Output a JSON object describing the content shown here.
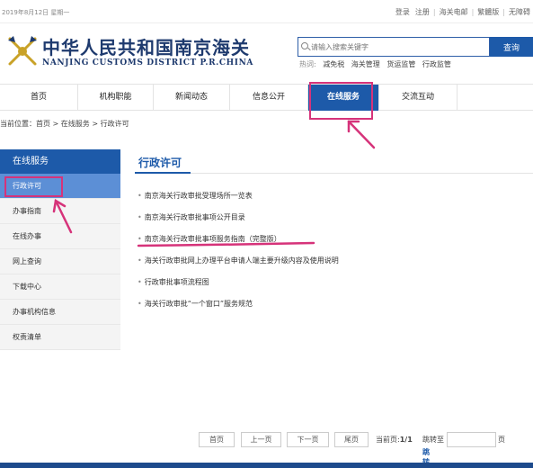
{
  "topbar": {
    "date": "2019年8月12日 星期一",
    "links": [
      "登录",
      "注册",
      "海关电邮",
      "繁體版",
      "无障碍"
    ]
  },
  "brand": {
    "title_cn": "中华人民共和国南京海关",
    "title_en": "NANJING CUSTOMS DISTRICT P.R.CHINA"
  },
  "search": {
    "placeholder": "请输入搜索关键字",
    "button": "查询",
    "hot_label": "热词:",
    "hot_words": [
      "减免税",
      "海关管理",
      "货运监管",
      "行政监管"
    ]
  },
  "nav": {
    "items": [
      "首页",
      "机构职能",
      "新闻动态",
      "信息公开",
      "在线服务",
      "交流互动"
    ],
    "active_index": 4
  },
  "breadcrumb": "当前位置：首页 > 在线服务 > 行政许可",
  "sidebar": {
    "title": "在线服务",
    "items": [
      "行政许可",
      "办事指南",
      "在线办事",
      "网上查询",
      "下载中心",
      "办事机构信息",
      "权责清单"
    ],
    "active_index": 0
  },
  "content": {
    "title": "行政许可",
    "items": [
      "南京海关行政审批受理场所一览表",
      "南京海关行政审批事项公开目录",
      "南京海关行政审批事项服务指南（完整版）",
      "海关行政审批网上办理平台申请人端主要升级内容及使用说明",
      "行政审批事项流程图",
      "海关行政审批“一个窗口”服务规范"
    ]
  },
  "pager": {
    "first": "首页",
    "prev": "上一页",
    "next": "下一页",
    "last": "尾页",
    "current_label": "当前页:",
    "current_value": "1/1",
    "jump_label": "跳转至",
    "page_unit": "页",
    "go": "跳转"
  },
  "colors": {
    "brand_blue": "#1d5aa9",
    "annotation": "#d6337a"
  }
}
